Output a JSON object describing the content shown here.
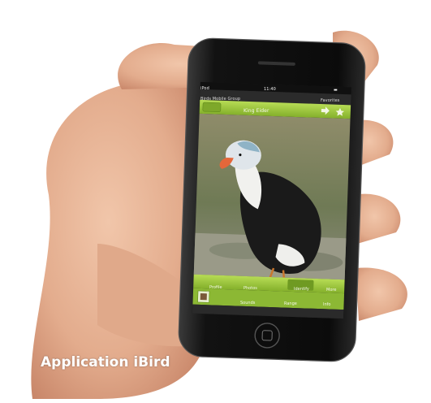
{
  "caption": "Application iBird",
  "phone": {
    "status_carrier": "iPod",
    "status_time": "11:40",
    "status_battery": "▬",
    "app_title": "Birds Mobile Group",
    "app_action": "Favorites",
    "toolbar_title": "King Eider",
    "tabs": [
      "Profile",
      "Photos",
      "Identify",
      "More"
    ],
    "subtabs": [
      "Sounds",
      "Range",
      "Info"
    ]
  },
  "colors": {
    "app_green": "#9cc53a",
    "app_green_dark": "#6f9a22",
    "skin": "#e8b79a",
    "phone_body": "#151515"
  },
  "icons": [
    "share-icon",
    "star-icon",
    "home-button-icon"
  ]
}
